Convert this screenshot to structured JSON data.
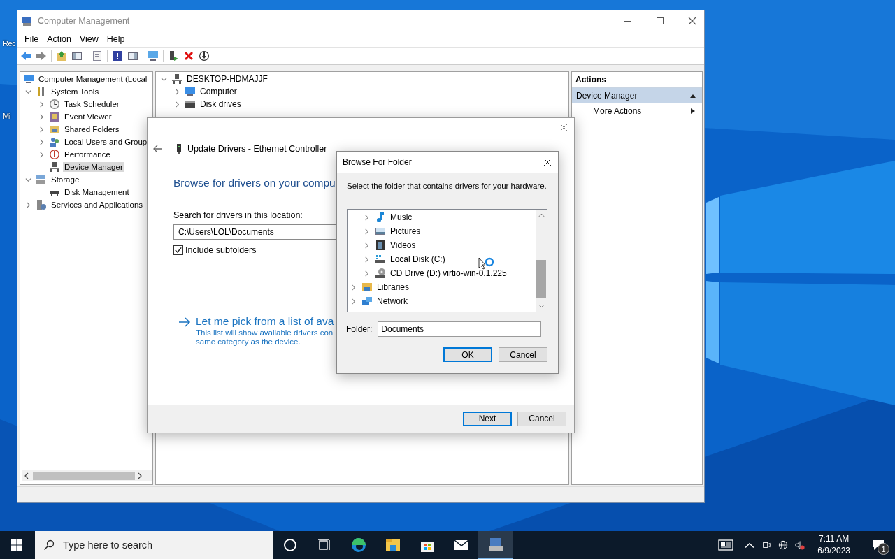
{
  "desktop": {
    "icons": [
      {
        "label": "Rec"
      },
      {
        "label": "Mi"
      }
    ]
  },
  "window": {
    "title": "Computer Management",
    "menu": [
      "File",
      "Action",
      "View",
      "Help"
    ],
    "toolbar": [
      {
        "kind": "back"
      },
      {
        "kind": "forward"
      },
      {
        "kind": "sep"
      },
      {
        "kind": "upfolder"
      },
      {
        "kind": "tree"
      },
      {
        "kind": "sep"
      },
      {
        "kind": "props"
      },
      {
        "kind": "sep"
      },
      {
        "kind": "help"
      },
      {
        "kind": "panel"
      },
      {
        "kind": "sep"
      },
      {
        "kind": "monitor"
      },
      {
        "kind": "sep"
      },
      {
        "kind": "update"
      },
      {
        "kind": "remove"
      },
      {
        "kind": "download"
      }
    ],
    "tree": [
      {
        "label": "Computer Management (Local",
        "kind": "computer",
        "selected": false,
        "children": [
          {
            "label": "System Tools",
            "kind": "tools",
            "expanded": true,
            "selected": false,
            "children": [
              {
                "label": "Task Scheduler",
                "kind": "clock",
                "expanded": false,
                "selected": false
              },
              {
                "label": "Event Viewer",
                "kind": "log",
                "expanded": false,
                "selected": false
              },
              {
                "label": "Shared Folders",
                "kind": "share",
                "expanded": false,
                "selected": false
              },
              {
                "label": "Local Users and Group",
                "kind": "users",
                "expanded": false,
                "selected": false
              },
              {
                "label": "Performance",
                "kind": "gauge",
                "expanded": false,
                "selected": false
              },
              {
                "label": "Device Manager",
                "kind": "device",
                "selected": true
              }
            ]
          },
          {
            "label": "Storage",
            "kind": "storage",
            "expanded": true,
            "selected": false,
            "children": [
              {
                "label": "Disk Management",
                "kind": "disk",
                "selected": false
              }
            ]
          },
          {
            "label": "Services and Applications",
            "kind": "services",
            "expanded": false,
            "selected": false
          }
        ]
      }
    ],
    "devices": [
      {
        "label": "DESKTOP-HDMAJJF",
        "kind": "device",
        "expanded": true,
        "children": [
          {
            "label": "Computer",
            "kind": "computer",
            "expanded": false
          },
          {
            "label": "Disk drives",
            "kind": "drive",
            "expanded": false
          }
        ]
      }
    ],
    "actions": {
      "title": "Actions",
      "section": "Device Manager",
      "items": [
        "More Actions"
      ]
    }
  },
  "update_dialog": {
    "title": "Update Drivers - Ethernet Controller",
    "heading": "Browse for drivers on your compu",
    "location_label": "Search for drivers in this location:",
    "location_value": "C:\\Users\\LOL\\Documents",
    "include_subfolders": {
      "label": "Include subfolders",
      "checked": true
    },
    "pick_link": {
      "title": "Let me pick from a list of ava",
      "description": [
        "This list will show available drivers con",
        "same category as the device."
      ]
    },
    "buttons": [
      {
        "label": "Next",
        "default": true
      },
      {
        "label": "Cancel",
        "default": false
      }
    ]
  },
  "browse_dialog": {
    "title": "Browse For Folder",
    "instruction": "Select the folder that contains drivers for your hardware.",
    "tree": [
      {
        "children": [
          {
            "label": "Music",
            "kind": "music",
            "expanded": false,
            "selected": false
          },
          {
            "label": "Pictures",
            "kind": "pictures",
            "expanded": false,
            "selected": false
          },
          {
            "label": "Videos",
            "kind": "videos",
            "expanded": false,
            "selected": false
          },
          {
            "label": "Local Disk (C:)",
            "kind": "hdd",
            "expanded": false,
            "selected": false
          },
          {
            "label": "CD Drive (D:) virtio-win-0.1.225",
            "kind": "cd",
            "expanded": false,
            "selected": false
          }
        ]
      },
      {
        "label": "Libraries",
        "kind": "library",
        "expanded": false,
        "selected": false
      },
      {
        "label": "Network",
        "kind": "network",
        "expanded": false,
        "selected": false
      }
    ],
    "folder_label": "Folder:",
    "folder_value": "Documents",
    "buttons": [
      {
        "label": "OK",
        "default": true
      },
      {
        "label": "Cancel",
        "default": false
      }
    ]
  },
  "taskbar": {
    "search_placeholder": "Type here to search",
    "apps": [
      {
        "kind": "cortana",
        "active": false
      },
      {
        "kind": "taskview",
        "active": false
      },
      {
        "kind": "edge",
        "active": false
      },
      {
        "kind": "explorer",
        "active": false
      },
      {
        "kind": "store",
        "active": false
      },
      {
        "kind": "mail",
        "active": false
      },
      {
        "kind": "compmgmt",
        "active": true
      }
    ],
    "time": "7:11 AM",
    "date": "6/9/2023",
    "notifications": "1"
  }
}
